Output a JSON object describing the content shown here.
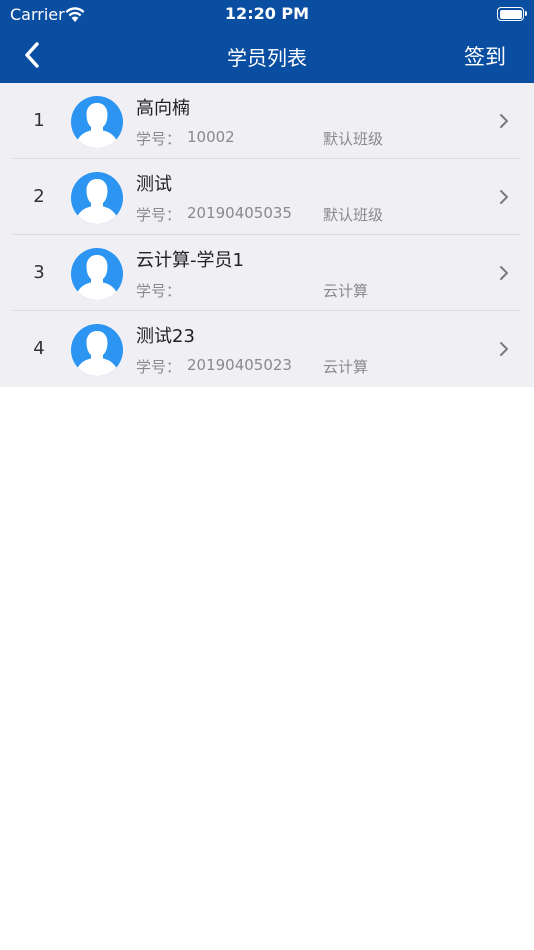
{
  "status_bar": {
    "carrier": "Carrier",
    "time": "12:20 PM",
    "icons": [
      "wifi-icon",
      "battery-icon"
    ]
  },
  "nav": {
    "back_icon": "chevron-left-icon",
    "title": "学员列表",
    "action_label": "签到"
  },
  "colors": {
    "nav_background": "#0a4ea2",
    "list_background": "#efeff4",
    "avatar_background": "#2b95f1"
  },
  "students": [
    {
      "index": "1",
      "name": "高向楠",
      "id_label": "学号：",
      "id_value": "10002",
      "class_name": "默认班级"
    },
    {
      "index": "2",
      "name": "测试",
      "id_label": "学号：",
      "id_value": "20190405035",
      "class_name": "默认班级"
    },
    {
      "index": "3",
      "name": "云计算-学员1",
      "id_label": "学号：",
      "id_value": "",
      "class_name": "云计算"
    },
    {
      "index": "4",
      "name": "测试23",
      "id_label": "学号：",
      "id_value": "20190405023",
      "class_name": "云计算"
    }
  ]
}
